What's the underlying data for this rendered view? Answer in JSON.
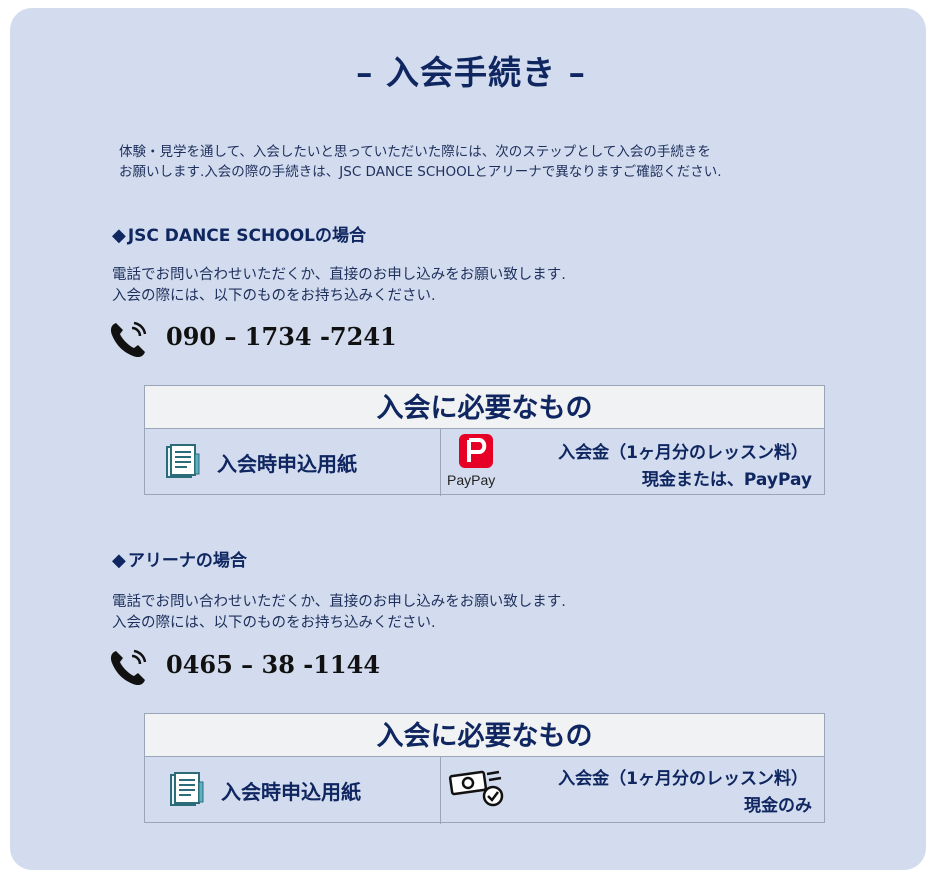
{
  "title": "– 入会手続き –",
  "intro": {
    "line1": "体験・見学を通して、入会したいと思っていただいた際には、次のステップとして入会の手続きを",
    "line2": "お願いします.入会の際の手続きは、JSC DANCE SCHOOLとアリーナで異なりますご確認ください."
  },
  "sections": [
    {
      "heading_mark": "◆",
      "heading": "JSC DANCE SCHOOLの場合",
      "desc1": "電話でお問い合わせいただくか、直接のお申し込みをお願い致します.",
      "desc2": "入会の際には、以下のものをお持ち込みください.",
      "phone": "090 – 1734 -7241",
      "req_title": "入会に必要なもの",
      "form_label": "入会時申込用紙",
      "fee_label": "入会金（1ヶ月分のレッスン料）",
      "payment": "現金または、PayPay",
      "payment_logo_text": "PayPay"
    },
    {
      "heading_mark": "◆",
      "heading": "アリーナの場合",
      "desc1": "電話でお問い合わせいただくか、直接のお申し込みをお願い致します.",
      "desc2": "入会の際には、以下のものをお持ち込みください.",
      "phone": "0465 – 38 -1144",
      "req_title": "入会に必要なもの",
      "form_label": "入会時申込用紙",
      "fee_label": "入会金（1ヶ月分のレッスン料）",
      "payment": "現金のみ"
    }
  ],
  "icons": {
    "phone": "phone-icon",
    "form": "document-icon",
    "paypay": "paypay-logo",
    "cash": "cash-icon"
  },
  "colors": {
    "background": "#d2dcee",
    "heading": "#0f2660",
    "paypay_red": "#e60026"
  }
}
